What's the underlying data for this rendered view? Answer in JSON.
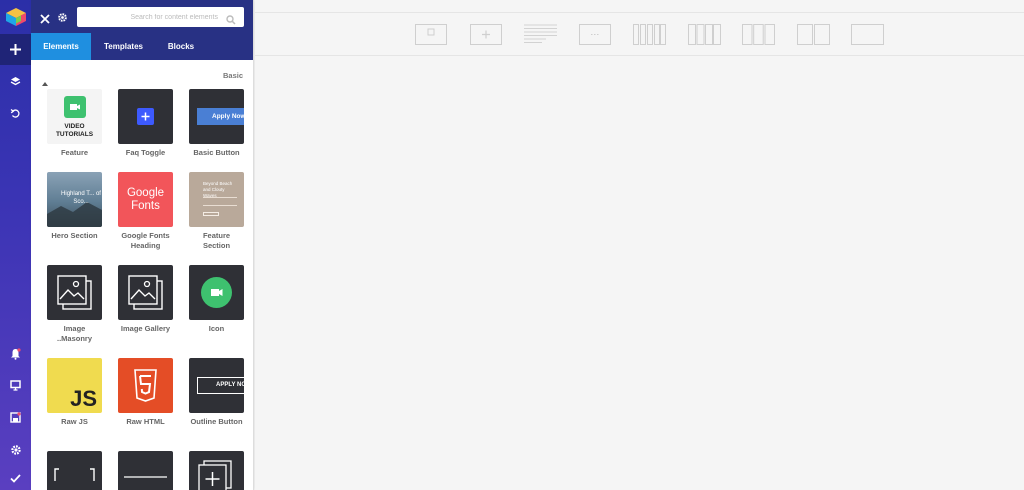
{
  "search": {
    "placeholder": "Search for content elements"
  },
  "tabs": [
    "Elements",
    "Templates",
    "Blocks"
  ],
  "section": {
    "title": "Basic"
  },
  "elements": [
    {
      "label": "Feature",
      "thumb_text": "VIDEO TUTORIALS"
    },
    {
      "label": "Faq Toggle"
    },
    {
      "label": "Basic Button",
      "thumb_text": "Apply Now"
    },
    {
      "label": "Hero Section",
      "thumb_text": "Highland T... of Sco..."
    },
    {
      "label": "Google Fonts Heading",
      "thumb_text": "Google Fonts"
    },
    {
      "label": "Feature Section",
      "thumb_text": "Beyond Beach and Clouty Waves"
    },
    {
      "label": "Image ..Masonry"
    },
    {
      "label": "Image Gallery"
    },
    {
      "label": "Icon"
    },
    {
      "label": "Raw JS",
      "thumb_text": "JS"
    },
    {
      "label": "Raw HTML"
    },
    {
      "label": "Outline Button",
      "thumb_text": "APPLY NO"
    }
  ],
  "colors": {
    "rail": "#3a34b4",
    "panel_header": "#283184",
    "active_tab": "#1f8fe0",
    "thumb_dark": "#2f3036",
    "accent_blue": "#3d5afe",
    "google_red": "#f2555a",
    "js_yellow": "#f0db4f",
    "html_orange": "#e44d26",
    "icon_green": "#3ec16f"
  },
  "icons": [
    "vc-logo-icon",
    "plus-icon",
    "layers-icon",
    "undo-icon",
    "bell-icon",
    "monitor-icon",
    "save-icon",
    "gear-icon",
    "check-icon",
    "close-icon",
    "search-icon",
    "caret-up-icon"
  ]
}
